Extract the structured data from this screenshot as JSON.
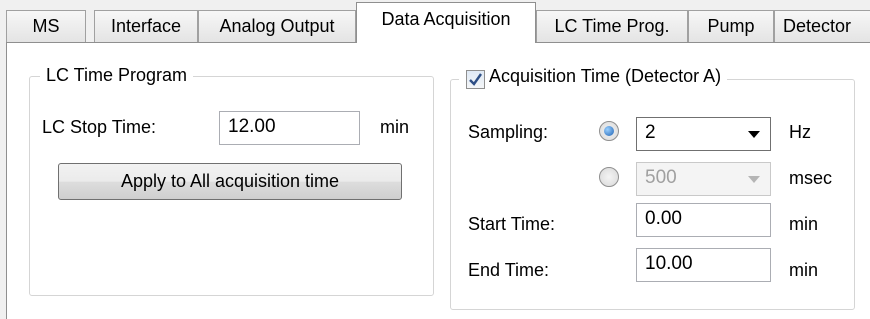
{
  "tabs": [
    {
      "label": "MS"
    },
    {
      "label": "Interface"
    },
    {
      "label": "Analog Output"
    },
    {
      "label": "Data Acquisition"
    },
    {
      "label": "LC Time Prog."
    },
    {
      "label": "Pump"
    },
    {
      "label": "Detector"
    }
  ],
  "active_tab": "Data Acquisition",
  "lc_group": {
    "title": "LC Time Program",
    "stop_time_label": "LC Stop Time:",
    "stop_time_value": "12.00",
    "stop_time_unit": "min",
    "apply_button": "Apply to All acquisition time"
  },
  "acq_group": {
    "title": "Acquisition Time (Detector A)",
    "checked": true,
    "sampling_label": "Sampling:",
    "sampling_hz_value": "2",
    "sampling_hz_unit": "Hz",
    "sampling_hz_selected": true,
    "sampling_msec_value": "500",
    "sampling_msec_unit": "msec",
    "start_time_label": "Start Time:",
    "start_time_value": "0.00",
    "start_time_unit": "min",
    "end_time_label": "End Time:",
    "end_time_value": "10.00",
    "end_time_unit": "min"
  },
  "icons": {
    "combo_arrow": "chevron-down-icon",
    "check": "check-icon"
  },
  "colors": {
    "radio_selected": "#1f62b3",
    "check_mark": "#2e4f86",
    "disabled_text": "#a0a0a0"
  }
}
